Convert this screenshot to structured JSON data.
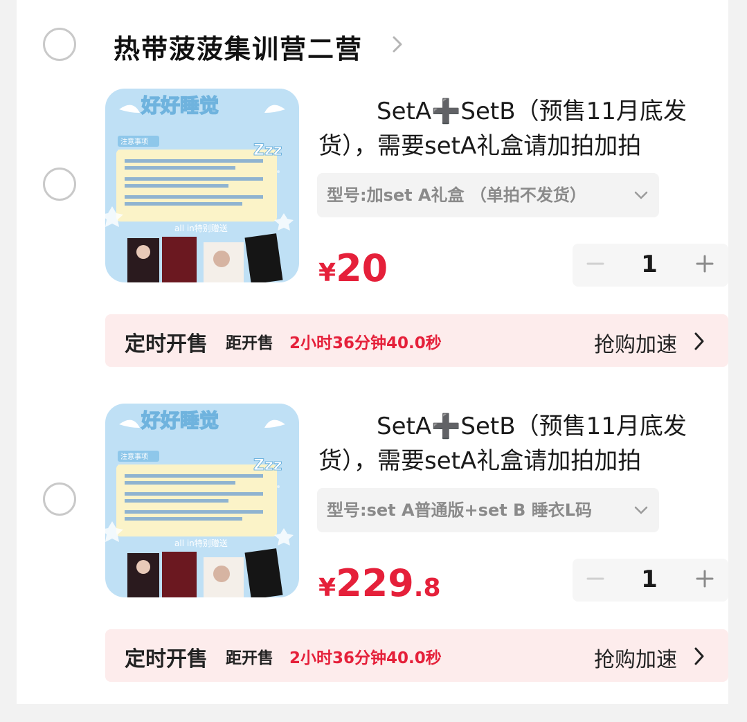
{
  "shop": {
    "name": "热带菠菠集训营二营"
  },
  "items": [
    {
      "title": "SetA➕SetB（预售11月底发货），需要setA礼盒请加拍加拍",
      "spec": "型号:加set  A礼盒 （单拍不发货）",
      "price": {
        "currency": "¥",
        "integer": "20",
        "decimal": ""
      },
      "quantity": "1",
      "sale": {
        "label": "定时开售",
        "distance_label": "距开售",
        "countdown": "2小时36分钟40.0秒",
        "accelerate": "抢购加速"
      },
      "thumb": {
        "top_text": "好好睡觉",
        "notice_tag": "注意事项",
        "special": "all in特别赠送",
        "zzz": "Zzz"
      }
    },
    {
      "title": "SetA➕SetB（预售11月底发货），需要setA礼盒请加拍加拍",
      "spec": "型号:set  A普通版+set  B  睡衣L码",
      "price": {
        "currency": "¥",
        "integer": "229",
        "decimal": ".8"
      },
      "quantity": "1",
      "sale": {
        "label": "定时开售",
        "distance_label": "距开售",
        "countdown": "2小时36分钟40.0秒",
        "accelerate": "抢购加速"
      },
      "thumb": {
        "top_text": "好好睡觉",
        "notice_tag": "注意事项",
        "special": "all in特别赠送",
        "zzz": "Zzz"
      }
    }
  ],
  "colors": {
    "price": "#e5203a",
    "sale_bg": "#fdecec",
    "countdown": "#e5203a"
  },
  "icons": {
    "shop_chevron": "chevron-right-icon",
    "spec_chevron": "chevron-down-icon",
    "minus": "minus-icon",
    "plus": "plus-icon"
  }
}
